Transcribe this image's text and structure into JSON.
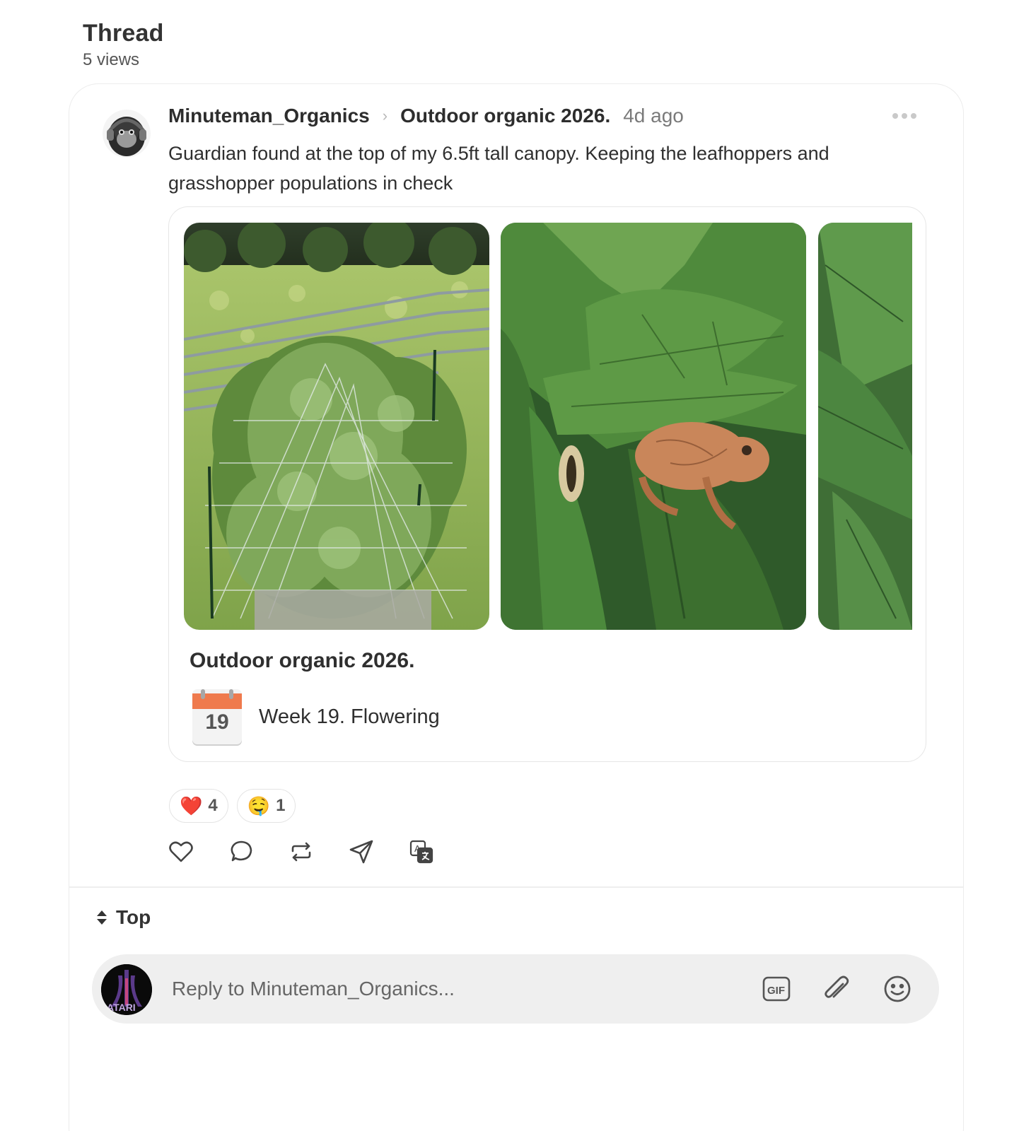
{
  "header": {
    "title": "Thread",
    "views": "5 views"
  },
  "post": {
    "author": "Minuteman_Organics",
    "separator": "›",
    "topic": "Outdoor organic 2026.",
    "time": "4d ago",
    "text": "Guardian found at the top of my 6.5ft tall canopy. Keeping the leafhoppers and grasshopper populations in check",
    "diary": {
      "title": "Outdoor organic 2026.",
      "calendar_day": "19",
      "week_label": "Week 19. Flowering"
    },
    "reactions": [
      {
        "emoji": "❤️",
        "count": "4"
      },
      {
        "emoji": "🤤",
        "count": "1"
      }
    ],
    "actions": [
      "heart-icon",
      "comment-icon",
      "repost-icon",
      "share-icon",
      "translate-icon"
    ]
  },
  "sort": {
    "label": "Top"
  },
  "reply": {
    "placeholder": "Reply to Minuteman_Organics...",
    "icons": [
      "gif-icon",
      "paperclip-icon",
      "smiley-icon"
    ]
  },
  "colors": {
    "accent_calendar": "#ef7a4d",
    "border": "#ececec",
    "reply_bg": "#efefef"
  }
}
